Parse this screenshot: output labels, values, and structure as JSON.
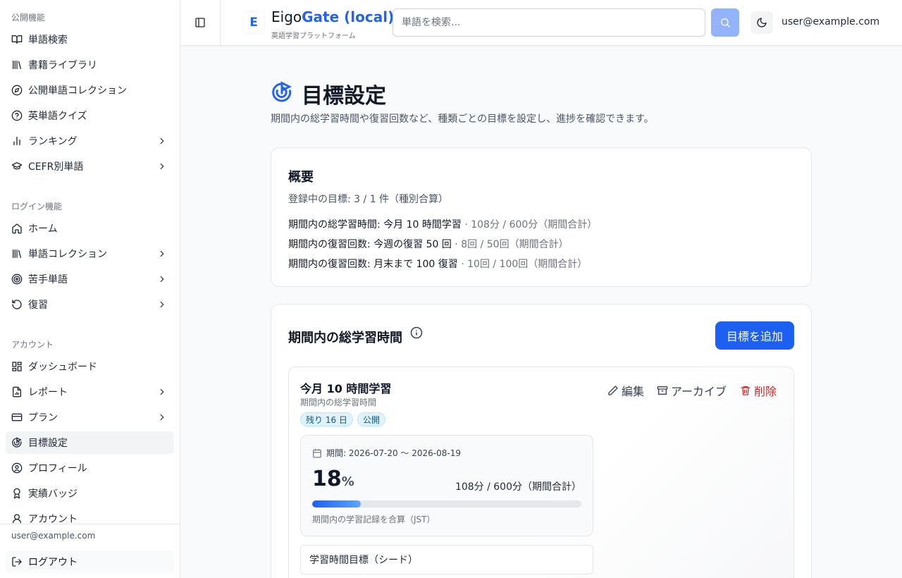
{
  "sidebar": {
    "sections": [
      {
        "label": "公開機能"
      },
      {
        "label": "ログイン機能"
      },
      {
        "label": "アカウント"
      }
    ],
    "items": [
      {
        "label": "単語検索",
        "icon": "book-open-icon"
      },
      {
        "label": "書籍ライブラリ",
        "icon": "library-icon"
      },
      {
        "label": "公開単語コレクション",
        "icon": "compass-icon"
      },
      {
        "label": "英単語クイズ",
        "icon": "help-circle-icon"
      },
      {
        "label": "ランキング",
        "icon": "bar-chart-icon"
      },
      {
        "label": "CEFR別単語",
        "icon": "graduation-cap-icon"
      },
      {
        "label": "ホーム",
        "icon": "home-icon"
      },
      {
        "label": "単語コレクション",
        "icon": "library-icon"
      },
      {
        "label": "苦手単語",
        "icon": "target-icon"
      },
      {
        "label": "復習",
        "icon": "rotate-ccw-icon"
      },
      {
        "label": "ダッシュボード",
        "icon": "layout-dashboard-icon"
      },
      {
        "label": "レポート",
        "icon": "file-chart-icon"
      },
      {
        "label": "プラン",
        "icon": "credit-card-icon"
      },
      {
        "label": "目標設定",
        "icon": "goal-icon"
      },
      {
        "label": "プロフィール",
        "icon": "user-circle-icon"
      },
      {
        "label": "実績バッジ",
        "icon": "award-icon"
      },
      {
        "label": "アカウント",
        "icon": "user-icon"
      }
    ],
    "footer": {
      "email": "user@example.com",
      "logout_label": "ログアウト"
    }
  },
  "header": {
    "logo_letter": "E",
    "brand_main": "Eigo",
    "brand_accent": "Gate (local)",
    "subtitle": "英語学習プラットフォーム",
    "search_placeholder": "単語を検索...",
    "user_email": "user@example.com"
  },
  "page": {
    "title": "目標設定",
    "description": "期間内の総学習時間や復習回数など、種類ごとの目標を設定し、進捗を確認できます。"
  },
  "summary": {
    "heading": "概要",
    "count_text": "登録中の目標: 3 / 1 件（種別合算）",
    "lines": [
      {
        "text": "期間内の総学習時間: 今月 10 時間学習",
        "muted": "· 108分 / 600分（期間合計）"
      },
      {
        "text": "期間内の復習回数: 今週の復習 50 回",
        "muted": "· 8回 / 50回（期間合計）"
      },
      {
        "text": "期間内の復習回数: 月末まで 100 復習",
        "muted": "· 10回 / 100回（期間合計）"
      }
    ]
  },
  "goals_section": {
    "heading": "期間内の総学習時間",
    "add_label": "目標を追加",
    "goal": {
      "title": "今月 10 時間学習",
      "type": "期間内の総学習時間",
      "badges": [
        "残り 16 日",
        "公開"
      ],
      "actions": {
        "edit": "編集",
        "archive": "アーカイブ",
        "delete": "削除"
      },
      "period": "期間: 2026-07-20 〜 2026-08-19",
      "percent": "18",
      "percent_unit": "%",
      "progress_fraction": 0.18,
      "amount": "108分 / 600分（期間合計）",
      "note": "期間内の学習記録を合算（JST）"
    },
    "next_item": "学習時間目標（シード）"
  },
  "colors": {
    "accent": "#2563eb",
    "danger": "#dc2626",
    "badge_bg": "#e0f2fe"
  }
}
